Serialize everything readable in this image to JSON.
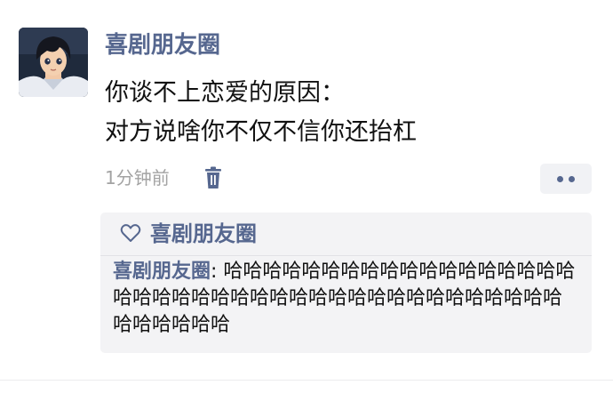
{
  "post": {
    "author": "喜剧朋友圈",
    "text_lines": [
      "你谈不上恋爱的原因：",
      "对方说啥你不仅不信你还抬杠"
    ],
    "time": "1分钟前",
    "avatar_icon": "anime-boy-avatar",
    "delete_icon": "trash-icon",
    "more_icon": "more-dots-icon"
  },
  "likes": {
    "icon": "heart-icon",
    "names": "喜剧朋友圈"
  },
  "comments": [
    {
      "author": "喜剧朋友圈",
      "separator": ": ",
      "text": "哈哈哈哈哈哈哈哈哈哈哈哈哈哈哈哈哈哈哈哈哈哈哈哈哈哈哈哈哈哈哈哈哈哈哈哈哈哈哈哈哈哈哈哈哈哈哈"
    }
  ],
  "colors": {
    "name_blue": "#56678f",
    "text": "#111111",
    "meta_gray": "#a3a3a3",
    "box_bg": "#f3f3f5"
  }
}
